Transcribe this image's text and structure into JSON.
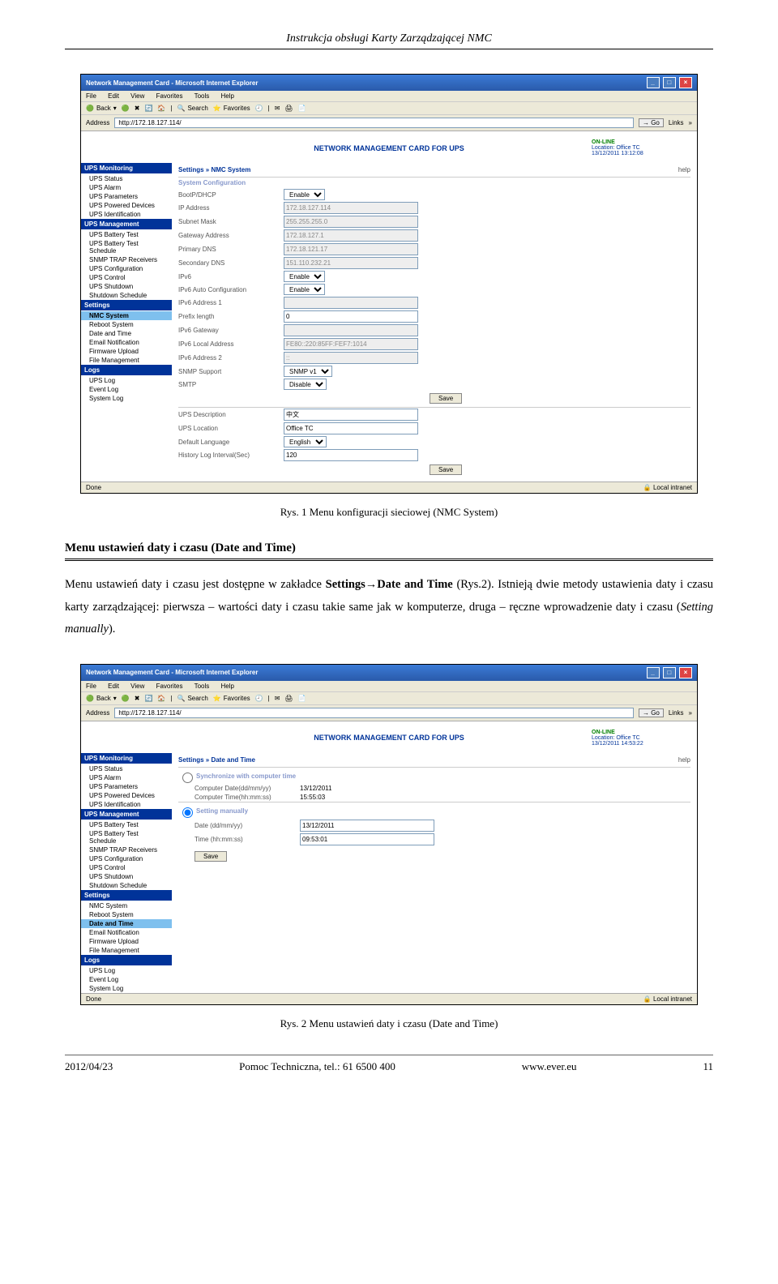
{
  "page_header": "Instrukcja obsługi Karty Zarządzającej NMC",
  "browser": {
    "title": "Network Management Card - Microsoft Internet Explorer",
    "menu": [
      "File",
      "Edit",
      "View",
      "Favorites",
      "Tools",
      "Help"
    ],
    "toolbar": {
      "back": "Back",
      "search": "Search",
      "favorites": "Favorites"
    },
    "address_label": "Address",
    "address_value": "http://172.18.127.114/",
    "go": "Go",
    "links": "Links",
    "status_done": "Done",
    "status_zone": "Local intranet"
  },
  "nmc_header": {
    "title": "NETWORK MANAGEMENT CARD FOR UPS",
    "status": "ON-LINE",
    "location": "Location: Office TC"
  },
  "sidebar": {
    "sections": [
      {
        "title": "UPS Monitoring",
        "items": [
          "UPS Status",
          "UPS Alarm",
          "UPS Parameters",
          "UPS Powered Devices",
          "UPS Identification"
        ]
      },
      {
        "title": "UPS Management",
        "items": [
          "UPS Battery Test",
          "UPS Battery Test Schedule",
          "SNMP TRAP Receivers",
          "UPS Configuration",
          "UPS Control",
          "UPS Shutdown",
          "Shutdown Schedule"
        ]
      },
      {
        "title": "Settings",
        "items": [
          "NMC System",
          "Reboot System",
          "Date and Time",
          "Email Notification",
          "Firmware Upload",
          "File Management"
        ]
      },
      {
        "title": "Logs",
        "items": [
          "UPS Log",
          "Event Log",
          "System Log"
        ]
      }
    ]
  },
  "screenshot1": {
    "datetime": "13/12/2011 13:12:08",
    "crumb": "Settings » NMC System",
    "help": "help",
    "sec_title": "System Configuration",
    "save": "Save",
    "rows": [
      {
        "label": "BootP/DHCP",
        "type": "select",
        "value": "Enable"
      },
      {
        "label": "IP Address",
        "type": "inputd",
        "value": "172.18.127.114"
      },
      {
        "label": "Subnet Mask",
        "type": "inputd",
        "value": "255.255.255.0"
      },
      {
        "label": "Gateway Address",
        "type": "inputd",
        "value": "172.18.127.1"
      },
      {
        "label": "Primary DNS",
        "type": "inputd",
        "value": "172.18.121.17"
      },
      {
        "label": "Secondary DNS",
        "type": "inputd",
        "value": "151.110.232.21"
      },
      {
        "label": "IPv6",
        "type": "select",
        "value": "Enable"
      },
      {
        "label": "IPv6 Auto Configuration",
        "type": "select",
        "value": "Enable"
      },
      {
        "label": "IPv6 Address 1",
        "type": "inputd",
        "value": ""
      },
      {
        "label": "Prefix length",
        "type": "input",
        "value": "0"
      },
      {
        "label": "IPv6 Gateway",
        "type": "inputd",
        "value": ""
      },
      {
        "label": "IPv6 Local Address",
        "type": "inputd",
        "value": "FE80::220:85FF:FEF7:1014"
      },
      {
        "label": "IPv6 Address 2",
        "type": "inputd",
        "value": "::"
      },
      {
        "label": "SNMP Support",
        "type": "select",
        "value": "SNMP v1"
      },
      {
        "label": "SMTP",
        "type": "select",
        "value": "Disable"
      }
    ],
    "rows2": [
      {
        "label": "UPS Description",
        "type": "input",
        "value": "中文"
      },
      {
        "label": "UPS Location",
        "type": "input",
        "value": "Office TC"
      },
      {
        "label": "Default Language",
        "type": "select",
        "value": "English"
      },
      {
        "label": "History Log Interval(Sec)",
        "type": "input",
        "value": "120"
      }
    ]
  },
  "caption1": "Rys. 1 Menu konfiguracji sieciowej (NMC System)",
  "section_title": "Menu ustawień daty i czasu (Date and Time)",
  "body_paragraph": "Menu ustawień daty i czasu jest dostępne w zakładce Settings→Date and Time (Rys.2). Istnieją dwie metody ustawienia daty i czasu karty zarządzającej: pierwsza – wartości daty i czasu takie same jak w komputerze, druga – ręczne wprowadzenie daty i czasu (Setting manually).",
  "screenshot2": {
    "datetime": "13/12/2011 14:53:22",
    "crumb": "Settings » Date and Time",
    "sync_title": "Synchronize with computer time",
    "comp_date_label": "Computer Date(dd/mm/yy)",
    "comp_date_value": "13/12/2011",
    "comp_time_label": "Computer Time(hh:mm:ss)",
    "comp_time_value": "15:55:03",
    "manual_title": "Setting manually",
    "date_label": "Date (dd/mm/yy)",
    "date_value": "13/12/2011",
    "time_label": "Time (hh:mm:ss)",
    "time_value": "09:53:01",
    "save": "Save"
  },
  "caption2": "Rys. 2 Menu ustawień daty i czasu (Date and Time)",
  "footer": {
    "left": "2012/04/23",
    "center": "Pomoc Techniczna, tel.: 61 6500 400",
    "right": "www.ever.eu",
    "page": "11"
  }
}
